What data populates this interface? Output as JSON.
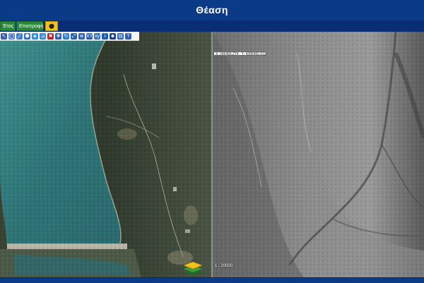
{
  "app": {
    "title": "Θέαση"
  },
  "menu": {
    "year_label": "Έτος ▾",
    "back_label": "Επιστροφή",
    "location_label": "⬤ ▾"
  },
  "toolbar": {
    "tools": [
      {
        "name": "select-arrow-icon",
        "glyph": "↖",
        "color": "#3a5fb0"
      },
      {
        "name": "globe-icon",
        "glyph": "◯",
        "color": "#5a7fc8"
      },
      {
        "name": "draw-line-icon",
        "glyph": "╱",
        "color": "#3c7fd0"
      },
      {
        "name": "draw-polygon-icon",
        "glyph": "⬟",
        "color": "#2c6ed0"
      },
      {
        "name": "shapes-icon",
        "glyph": "◈",
        "color": "#2d8fe0"
      },
      {
        "name": "measure-icon",
        "glyph": "⊿",
        "color": "#3a8fd8"
      },
      {
        "name": "clear-icon",
        "glyph": "✖",
        "color": "#c02020"
      },
      {
        "name": "pan-icon",
        "glyph": "✥",
        "color": "#2a60b8"
      },
      {
        "name": "refresh-icon",
        "glyph": "↻",
        "color": "#2a80d0"
      },
      {
        "name": "zoom-to-icon",
        "glyph": "⤢",
        "color": "#2a60b8"
      },
      {
        "name": "list-icon",
        "glyph": "≣",
        "color": "#2a60b8"
      },
      {
        "name": "xy-coordinates-icon",
        "glyph": "XY",
        "color": "#2a60b8"
      },
      {
        "name": "xy-search-icon",
        "glyph": "xy",
        "color": "#2a70c0"
      },
      {
        "name": "info-icon",
        "glyph": "i",
        "color": "#1a5fc0"
      },
      {
        "name": "person-icon",
        "glyph": "☻",
        "color": "#1a3f90"
      },
      {
        "name": "print-icon",
        "glyph": "▤",
        "color": "#2a60b8"
      },
      {
        "name": "help-icon",
        "glyph": "?",
        "color": "#2a60b8"
      }
    ]
  },
  "map": {
    "coordinate_readout": "X: 245456.274 , Y: 4286965.011",
    "scale_label": "1 : 20000"
  }
}
